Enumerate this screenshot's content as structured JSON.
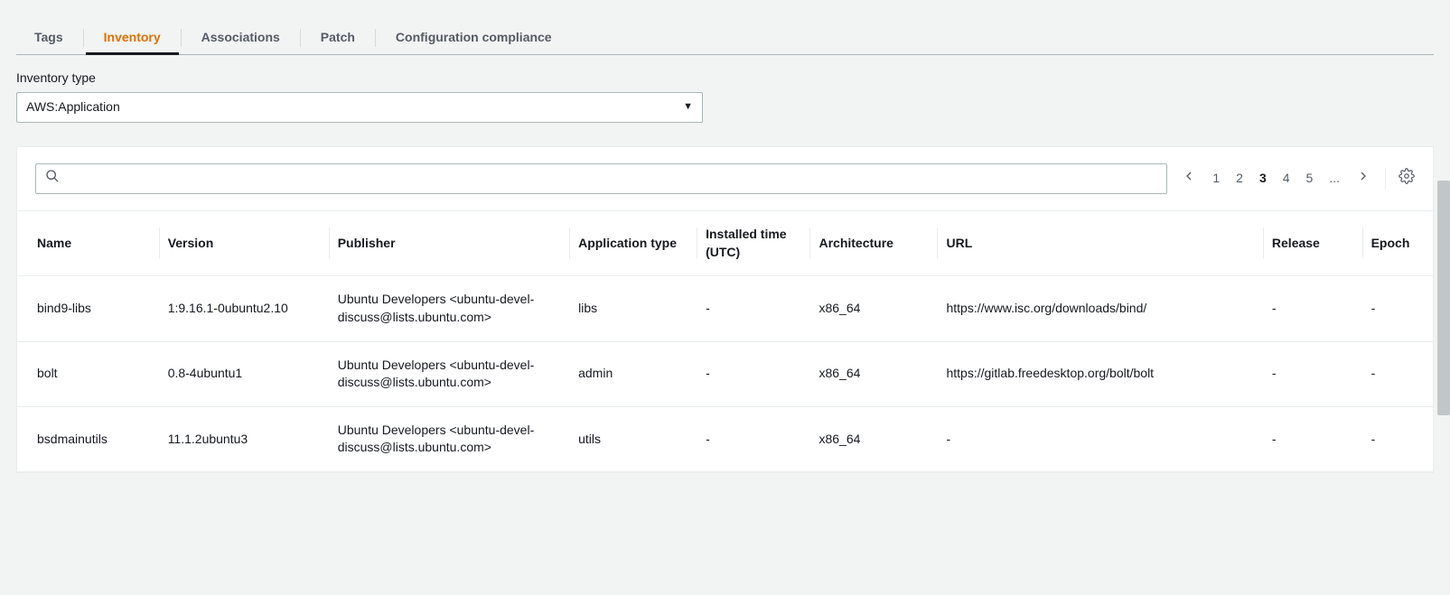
{
  "tabs": [
    {
      "label": "Tags",
      "active": false
    },
    {
      "label": "Inventory",
      "active": true
    },
    {
      "label": "Associations",
      "active": false
    },
    {
      "label": "Patch",
      "active": false
    },
    {
      "label": "Configuration compliance",
      "active": false
    }
  ],
  "inventory_type": {
    "label": "Inventory type",
    "value": "AWS:Application"
  },
  "search": {
    "placeholder": ""
  },
  "pager": {
    "pages": [
      "1",
      "2",
      "3",
      "4",
      "5",
      "..."
    ],
    "current": "3"
  },
  "table": {
    "columns": [
      "Name",
      "Version",
      "Publisher",
      "Application type",
      "Installed time (UTC)",
      "Architecture",
      "URL",
      "Release",
      "Epoch"
    ],
    "rows": [
      {
        "name": "bind9-libs",
        "version": "1:9.16.1-0ubuntu2.10",
        "publisher": "Ubuntu Developers <ubuntu-devel-discuss@lists.ubuntu.com>",
        "apptype": "libs",
        "installed": "-",
        "arch": "x86_64",
        "url": "https://www.isc.org/downloads/bind/",
        "release": "-",
        "epoch": "-"
      },
      {
        "name": "bolt",
        "version": "0.8-4ubuntu1",
        "publisher": "Ubuntu Developers <ubuntu-devel-discuss@lists.ubuntu.com>",
        "apptype": "admin",
        "installed": "-",
        "arch": "x86_64",
        "url": "https://gitlab.freedesktop.org/bolt/bolt",
        "release": "-",
        "epoch": "-"
      },
      {
        "name": "bsdmainutils",
        "version": "11.1.2ubuntu3",
        "publisher": "Ubuntu Developers <ubuntu-devel-discuss@lists.ubuntu.com>",
        "apptype": "utils",
        "installed": "-",
        "arch": "x86_64",
        "url": "-",
        "release": "-",
        "epoch": "-"
      }
    ]
  }
}
